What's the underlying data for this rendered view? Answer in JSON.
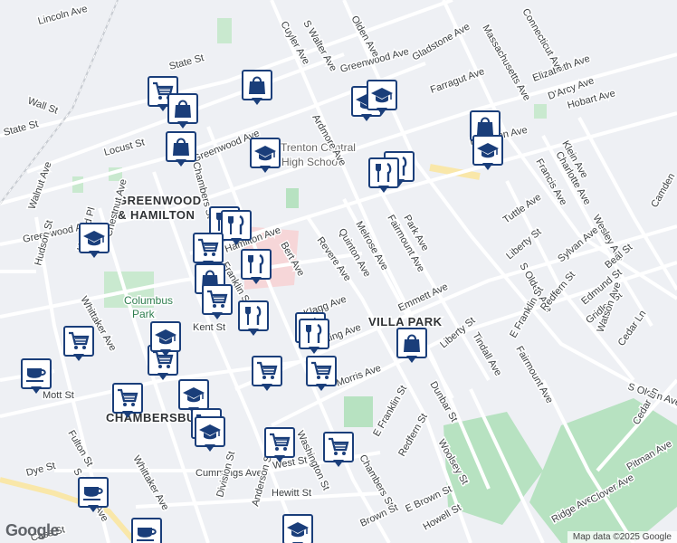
{
  "map": {
    "areas": [
      "GREENWOOD",
      "& HAMILTON",
      "VILLA PARK",
      "CHAMBERSBURG"
    ],
    "parks": [
      "Columbus",
      "Park"
    ],
    "pois": [
      "Trenton Central",
      "High School"
    ],
    "streets": [
      "Lincoln Ave",
      "State St",
      "State St",
      "Wall St",
      "Locust St",
      "Greenwood Ave",
      "Greenwood Ave",
      "Greenwood Ave",
      "Hamilton Ave",
      "Hamilton Ave",
      "Cuyler Ave",
      "S Walter Ave",
      "Olden Ave",
      "Gladstone Ave",
      "Farragut Ave",
      "Elizabeth Ave",
      "D'Arcy Ave",
      "Hobart Ave",
      "Massachusetts Ave",
      "Connecticut Ave",
      "Ardmore Ave",
      "Walnut Ave",
      "Hudson St",
      "Harford Pl",
      "Chestnut Ave",
      "Whittaker Ave",
      "Whittaker Ave",
      "Chambers St",
      "Chambers St",
      "Bert Ave",
      "Revere Ave",
      "Quinton Ave",
      "Melrose Ave",
      "Fairmount Ave",
      "Park Ave",
      "Emmett Ave",
      "Liberty St",
      "Liberty St",
      "S Olden Ave",
      "S Olden Ave",
      "E Franklin St",
      "E Franklin St",
      "Redfern St",
      "Redfern St",
      "Tindall Ave",
      "Fairmount Ave",
      "Dunbar St",
      "Woolsey St",
      "Morris Ave",
      "Washington St",
      "Cummings Ave",
      "West St",
      "Hewitt St",
      "Fulton St",
      "S Clinton Ave",
      "Dye St",
      "Cass St",
      "Division St",
      "Anderson St",
      "Brown St",
      "E Brown St",
      "Howell St",
      "Ridge Ave",
      "Clover Ave",
      "Pitman Ave",
      "Cedar Ln",
      "Cedar Ln",
      "Tuttle Ave",
      "Francis Ave",
      "Charlotte Ave",
      "Klein Ave",
      "Wesley Ave",
      "Beal St",
      "Sylvan Ave",
      "Edmund St",
      "Gridley St",
      "Watson Ave",
      "Kent St",
      "Mott St",
      "Franklin St",
      "Rolling Ave",
      "Klagg Ave",
      "Camden"
    ],
    "markers": [
      {
        "type": "cart"
      },
      {
        "type": "bag"
      },
      {
        "type": "bag"
      },
      {
        "type": "bag"
      },
      {
        "type": "school"
      },
      {
        "type": "school"
      },
      {
        "type": "school"
      },
      {
        "type": "bag"
      },
      {
        "type": "school"
      },
      {
        "type": "food"
      },
      {
        "type": "food"
      },
      {
        "type": "school"
      },
      {
        "type": "food"
      },
      {
        "type": "food"
      },
      {
        "type": "cart"
      },
      {
        "type": "bag"
      },
      {
        "type": "food"
      },
      {
        "type": "cart"
      },
      {
        "type": "food"
      },
      {
        "type": "food"
      },
      {
        "type": "food"
      },
      {
        "type": "bag"
      },
      {
        "type": "cart"
      },
      {
        "type": "cart"
      },
      {
        "type": "school"
      },
      {
        "type": "school"
      },
      {
        "type": "cart"
      },
      {
        "type": "cafe"
      },
      {
        "type": "cart"
      },
      {
        "type": "school"
      },
      {
        "type": "cart"
      },
      {
        "type": "cart"
      },
      {
        "type": "cart"
      },
      {
        "type": "cart"
      },
      {
        "type": "cafe"
      },
      {
        "type": "cafe"
      },
      {
        "type": "school"
      }
    ],
    "colors": {
      "road": "#ffffff",
      "road_major": "#f4f5f8",
      "park": "#b7e2c1",
      "poi": "#f6d6d8",
      "pin_border": "#1a3e7a",
      "yellow": "#f9e7a9"
    }
  },
  "attribution": "Map data ©2025 Google",
  "logo": "Google"
}
